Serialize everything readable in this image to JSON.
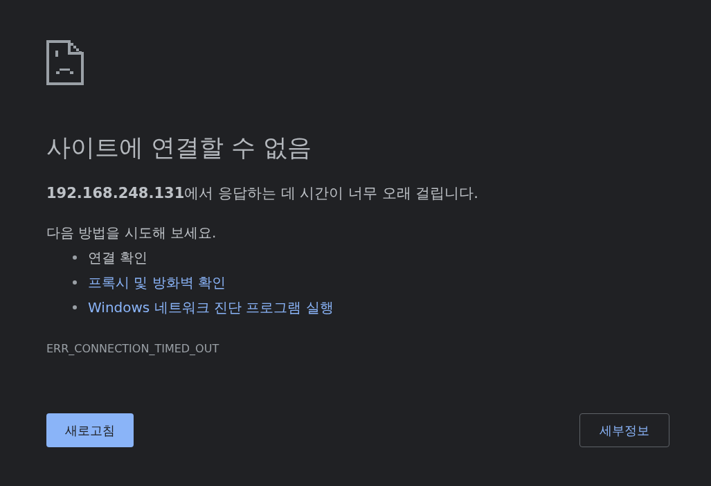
{
  "heading": "사이트에 연결할 수 없음",
  "message": "**192.168.248.131**에서 응답하는 데 시간이 너무 오래 걸립니다.",
  "suggestions": {
    "intro": "다음 방법을 시도해 보세요.",
    "items": [
      {
        "text": "연결 확인",
        "kind": "text"
      },
      {
        "text": "프록시 및 방화벽 확인",
        "kind": "link"
      },
      {
        "text": "Windows 네트워크 진단 프로그램 실행",
        "kind": "link"
      }
    ]
  },
  "error_code": "ERR_CONNECTION_TIMED_OUT",
  "buttons": [
    {
      "label": "새로고침",
      "kind": "primary"
    },
    {
      "label": "세부정보",
      "kind": "secondary"
    }
  ]
}
